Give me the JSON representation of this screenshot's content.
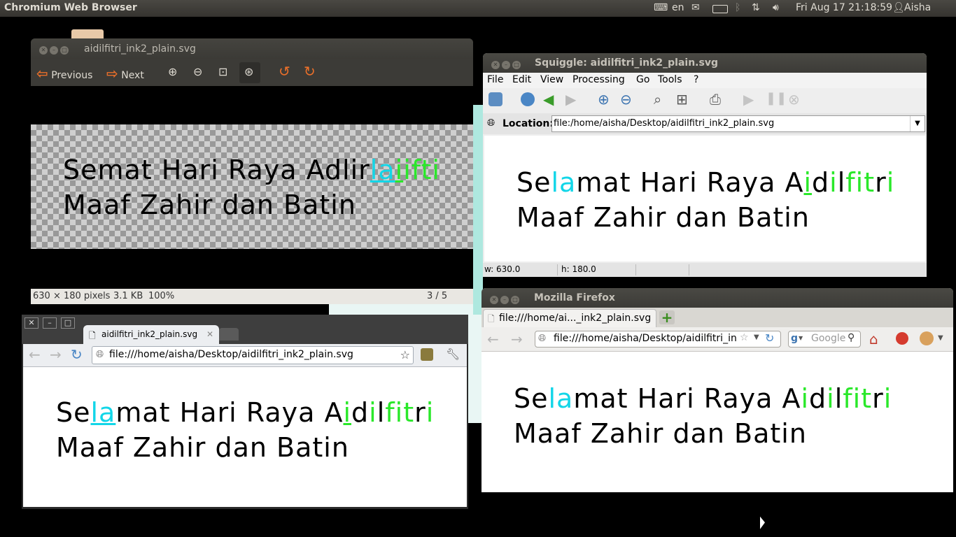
{
  "top_panel": {
    "app_name": "Chromium Web Browser",
    "keyboard_layout": "en",
    "datetime": "Fri Aug 17 21:18:59",
    "user": "Aisha"
  },
  "eog": {
    "title": "aidilfitri_ink2_plain.svg",
    "previous_label": "Previous",
    "next_label": "Next",
    "text": {
      "l1a": "Semat Hari Raya Adlir",
      "l1b": "la",
      "l1c": "i",
      "l1d": "ifti",
      "line2": "Maaf Zahir dan Batin"
    },
    "status": {
      "dimensions": "630 × 180 pixels",
      "size": "3.1 KB",
      "zoom": "100%",
      "position": "3 / 5"
    }
  },
  "squiggle": {
    "title": "Squiggle: aidilfitri_ink2_plain.svg",
    "menu": [
      "File",
      "Edit",
      "View",
      "Processing",
      "Go",
      "Tools",
      "?"
    ],
    "location_label": "Location:",
    "location_value": "file:/home/aisha/Desktop/aidilfitri_ink2_plain.svg",
    "status_w": "w: 630.0",
    "status_h": "h: 180.0"
  },
  "chromium": {
    "tab_title": "aidilfitri_ink2_plain.svg",
    "url": "file:///home/aisha/Desktop/aidilfitri_ink2_plain.svg"
  },
  "firefox": {
    "title": "Mozilla Firefox",
    "tab_title": "file:///home/ai..._ink2_plain.svg",
    "url": "file:///home/aisha/Desktop/aidilfitri_in",
    "search_placeholder": "Google"
  },
  "svg_text": {
    "se": "Se",
    "la": "la",
    "mat_hari_raya_a": "mat Hari Raya A",
    "i1": "i",
    "d": "d",
    "i2": "i",
    "l": "l",
    "f": "f",
    "i3": "i",
    "t": "t",
    "r": "r",
    "i4": "i",
    "line2": "Maaf Zahir dan Batin"
  },
  "colors": {
    "cyan": "#12d6e8",
    "green": "#2ae82a",
    "panel_bg": "#3c3b37",
    "accent_orange": "#e96f2a"
  }
}
